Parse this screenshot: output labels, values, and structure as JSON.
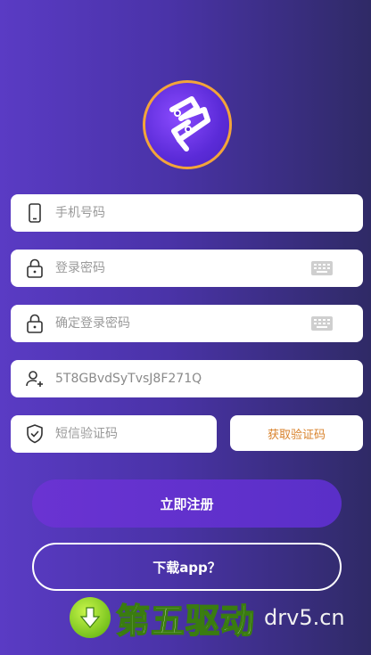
{
  "form": {
    "phone": {
      "placeholder": "手机号码",
      "value": ""
    },
    "password": {
      "placeholder": "登录密码",
      "value": ""
    },
    "confirm_password": {
      "placeholder": "确定登录密码",
      "value": ""
    },
    "invite_code": {
      "placeholder": "",
      "value": "5T8GBvdSyTvsJ8F271Q"
    },
    "sms_code": {
      "placeholder": "短信验证码",
      "value": ""
    },
    "get_code_label": "获取验证码"
  },
  "actions": {
    "register_label": "立即注册",
    "download_label": "下载app？"
  },
  "watermark": {
    "brand": "第五驱动",
    "site": "drv5.cn"
  },
  "colors": {
    "bg_start": "#5a3bc4",
    "bg_end": "#2f2a66",
    "accent_orange": "#d9822b",
    "logo_ring": "#f3a43a",
    "register_button": "#6a33d2"
  },
  "icons": {
    "phone": "phone-icon",
    "lock": "lock-icon",
    "keyboard": "keyboard-icon",
    "user_plus": "user-plus-icon",
    "shield": "shield-check-icon",
    "download_arrow": "download-arrow-icon"
  }
}
